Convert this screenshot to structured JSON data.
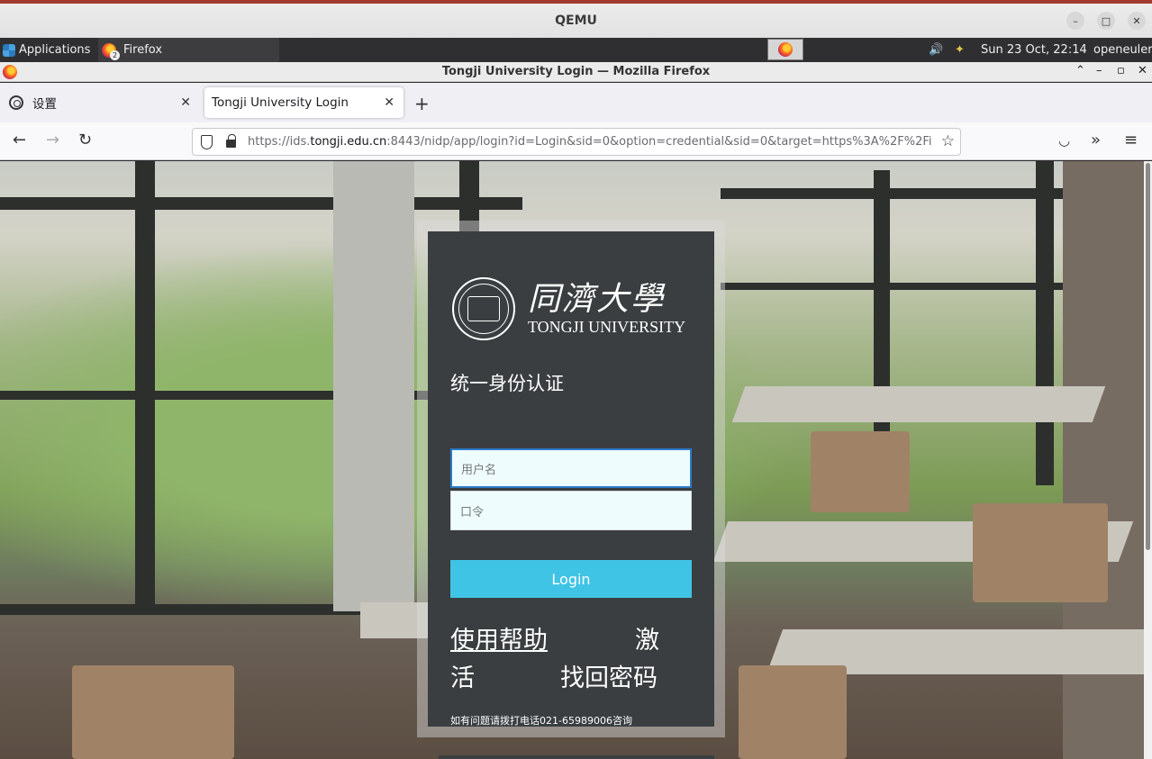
{
  "qemu": {
    "title": "QEMU"
  },
  "panel": {
    "applications": "Applications",
    "task_label": "Firefox",
    "task_badge": "2",
    "clock": "Sun 23 Oct, 22:14",
    "user": "openeuler"
  },
  "window": {
    "title": "Tongji University Login — Mozilla Firefox"
  },
  "tabs": [
    {
      "label": "设置",
      "icon": "gear-icon"
    },
    {
      "label": "Tongji University Login",
      "active": true
    }
  ],
  "address_bar": {
    "prefix": "https://ids.",
    "domain": "tongji.edu.cn",
    "suffix": ":8443/nidp/app/login?id=Login&sid=0&option=credential&sid=0&target=https%3A%2F%2Fi"
  },
  "login": {
    "logo_cn": "同濟大學",
    "logo_en": "TONGJI UNIVERSITY",
    "subtitle": "统一身份认证",
    "username_placeholder": "用户名",
    "password_placeholder": "口令",
    "login_button": "Login",
    "help_link": "使用帮助",
    "activate_link_part1": "激",
    "activate_link_part2": "活",
    "reset_link": "找回密码",
    "contact_hint": "如有问题请拨打电话021-65989006咨询"
  },
  "colors": {
    "login_button": "#3fc4e6",
    "login_panel": "#3a3e40",
    "input_bg": "#eefcfe",
    "qemu_accent": "#a33a2e"
  }
}
